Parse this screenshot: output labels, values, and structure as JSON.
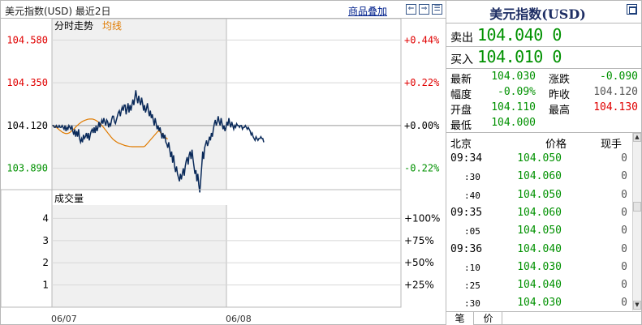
{
  "chart_header": {
    "title": "美元指数(USD) 最近2日",
    "overlay_link": "商品叠加",
    "btn_prev": "⇐",
    "btn_next": "⇒",
    "btn_menu": "☰"
  },
  "chart_data": [
    {
      "type": "line",
      "legend": [
        "分时走势",
        "均线"
      ],
      "y_ticks": [
        "104.580",
        "104.350",
        "104.120",
        "103.890"
      ],
      "y_tick_values": [
        104.58,
        104.35,
        104.12,
        103.89
      ],
      "pct_ticks": [
        "+0.44%",
        "+0.22%",
        "+0.00%",
        "-0.22%"
      ],
      "ylim": [
        103.775,
        104.695
      ],
      "prev_close": 104.12,
      "x_labels": [
        "06/07",
        "06/08"
      ],
      "day1_points": 180,
      "day2_points_total": 180,
      "series": [
        {
          "name": "分时走势",
          "color": "#0a2a5a",
          "values": [
            104.12,
            104.12,
            104.11,
            104.11,
            104.12,
            104.11,
            104.11,
            104.12,
            104.11,
            104.11,
            104.12,
            104.11,
            104.1,
            104.12,
            104.09,
            104.11,
            104.1,
            104.12,
            104.11,
            104.1,
            104.12,
            104.09,
            104.07,
            104.1,
            104.06,
            104.09,
            104.06,
            104.1,
            104.05,
            104.03,
            104.05,
            104.03,
            104.07,
            104.05,
            104.06,
            104.08,
            104.05,
            104.08,
            104.04,
            104.07,
            104.09,
            104.1,
            104.08,
            104.11,
            104.08,
            104.12,
            104.09,
            104.11,
            104.14,
            104.11,
            104.13,
            104.15,
            104.13,
            104.16,
            104.14,
            104.12,
            104.15,
            104.14,
            104.11,
            104.13,
            104.12,
            104.15,
            104.17,
            104.17,
            104.14,
            104.13,
            104.15,
            104.17,
            104.19,
            104.2,
            104.17,
            104.2,
            104.22,
            104.2,
            104.23,
            104.23,
            104.18,
            104.21,
            104.24,
            104.19,
            104.23,
            104.2,
            104.23,
            104.26,
            104.23,
            104.27,
            104.31,
            104.27,
            104.24,
            104.28,
            104.25,
            104.23,
            104.27,
            104.24,
            104.2,
            104.23,
            104.19,
            104.21,
            104.24,
            104.2,
            104.17,
            104.2,
            104.16,
            104.18,
            104.15,
            104.12,
            104.16,
            104.13,
            104.1,
            104.12,
            104.09,
            104.11,
            104.08,
            104.05,
            104.08,
            104.05,
            104.07,
            104.03,
            104.02,
            104.0,
            104.03,
            103.99,
            103.95,
            103.98,
            103.92,
            103.96,
            103.9,
            103.87,
            103.9,
            103.86,
            103.84,
            103.82,
            103.86,
            103.83,
            103.86,
            103.89,
            103.85,
            103.9,
            103.93,
            103.95,
            103.91,
            103.96,
            103.98,
            103.94,
            103.99,
            103.94,
            103.9,
            103.86,
            103.88,
            103.82,
            103.86,
            103.8,
            103.76,
            103.83,
            103.9,
            103.98,
            103.94,
            104.0,
            104.02,
            104.04,
            104.01,
            104.03,
            104.06,
            104.04,
            104.08,
            104.06,
            104.1,
            104.13,
            104.15,
            104.12,
            104.14,
            104.17,
            104.14,
            104.12,
            104.16,
            104.13,
            104.1,
            104.12,
            104.09,
            104.11,
            104.14,
            104.12,
            104.16,
            104.13,
            104.11,
            104.14,
            104.12,
            104.1,
            104.12,
            104.11,
            104.13,
            104.12,
            104.12,
            104.11,
            104.12,
            104.12,
            104.1,
            104.11,
            104.11,
            104.12,
            104.11,
            104.1,
            104.11,
            104.1,
            104.09,
            104.07,
            104.08,
            104.06,
            104.05,
            104.04,
            104.06,
            104.05,
            104.04,
            104.05,
            104.05,
            104.06,
            104.05,
            104.05,
            104.03
          ]
        },
        {
          "name": "均线",
          "color": "#e07b00",
          "values": [
            104.12,
            104.118,
            104.116,
            104.113,
            104.11,
            104.106,
            104.102,
            104.097,
            104.093,
            104.089,
            104.085,
            104.082,
            104.08,
            104.078,
            104.077,
            104.077,
            104.078,
            104.08,
            104.083,
            104.087,
            104.091,
            104.096,
            104.101,
            104.106,
            104.112,
            104.117,
            104.122,
            104.127,
            104.131,
            104.135,
            104.139,
            104.142,
            104.145,
            104.147,
            104.149,
            104.151,
            104.153,
            104.154,
            104.155,
            104.155,
            104.155,
            104.155,
            104.154,
            104.152,
            104.15,
            104.147,
            104.144,
            104.14,
            104.136,
            104.131,
            104.126,
            104.12,
            104.114,
            104.108,
            104.101,
            104.095,
            104.088,
            104.081,
            104.074,
            104.068,
            104.061,
            104.055,
            104.049,
            104.044,
            104.04,
            104.036,
            104.032,
            104.029,
            104.026,
            104.024,
            104.022,
            104.02,
            104.018,
            104.016,
            104.014,
            104.012,
            104.011,
            104.01,
            104.009,
            104.008,
            104.007,
            104.007,
            104.006,
            104.006,
            104.006,
            104.006,
            104.006,
            104.006,
            104.006,
            104.006,
            104.006,
            104.006,
            104.006,
            104.006,
            104.006,
            104.008,
            104.012,
            104.018,
            104.024,
            104.03,
            104.036,
            104.042,
            104.048,
            104.054,
            104.06,
            104.066,
            104.072,
            104.078,
            104.084,
            104.09,
            104.09,
            104.085,
            104.08,
            104.075,
            104.07,
            104.065,
            104.06,
            104.055,
            104.05,
            104.048
          ]
        }
      ]
    },
    {
      "type": "bar",
      "legend": [
        "成交量"
      ],
      "y_ticks": [
        "4",
        "3",
        "2",
        "1"
      ],
      "y_tick_values": [
        4,
        3,
        2,
        1
      ],
      "pct_ticks": [
        "+100%",
        "+75%",
        "+50%",
        "+25%"
      ],
      "ylim": [
        0,
        4.6
      ],
      "values": []
    }
  ],
  "quote": {
    "title": "美元指数(USD)",
    "sell_label": "卖出",
    "sell_value": "104.040 0",
    "buy_label": "买入",
    "buy_value": "104.010 0",
    "stats": [
      {
        "label": "最新",
        "value": "104.030",
        "color": "green"
      },
      {
        "label": "涨跌",
        "value": "-0.090",
        "color": "green"
      },
      {
        "label": "幅度",
        "value": "-0.09%",
        "color": "green"
      },
      {
        "label": "昨收",
        "value": "104.120",
        "color": "gray"
      },
      {
        "label": "开盘",
        "value": "104.110",
        "color": "green"
      },
      {
        "label": "最高",
        "value": "104.130",
        "color": "red"
      },
      {
        "label": "最低",
        "value": "104.000",
        "color": "green"
      }
    ],
    "tick_headers": {
      "location": "北京",
      "price": "价格",
      "volume": "现手"
    },
    "ticks": [
      {
        "time": "09:34",
        "price": "104.050",
        "vol": "0",
        "sub": false
      },
      {
        "time": ":30",
        "price": "104.060",
        "vol": "0",
        "sub": true
      },
      {
        "time": ":40",
        "price": "104.050",
        "vol": "0",
        "sub": true
      },
      {
        "time": "09:35",
        "price": "104.060",
        "vol": "0",
        "sub": false
      },
      {
        "time": ":05",
        "price": "104.050",
        "vol": "0",
        "sub": true
      },
      {
        "time": "09:36",
        "price": "104.040",
        "vol": "0",
        "sub": false
      },
      {
        "time": ":10",
        "price": "104.030",
        "vol": "0",
        "sub": true
      },
      {
        "time": ":25",
        "price": "104.040",
        "vol": "0",
        "sub": true
      },
      {
        "time": ":30",
        "price": "104.030",
        "vol": "0",
        "sub": true
      }
    ],
    "tabs": [
      "笔",
      "价"
    ]
  }
}
